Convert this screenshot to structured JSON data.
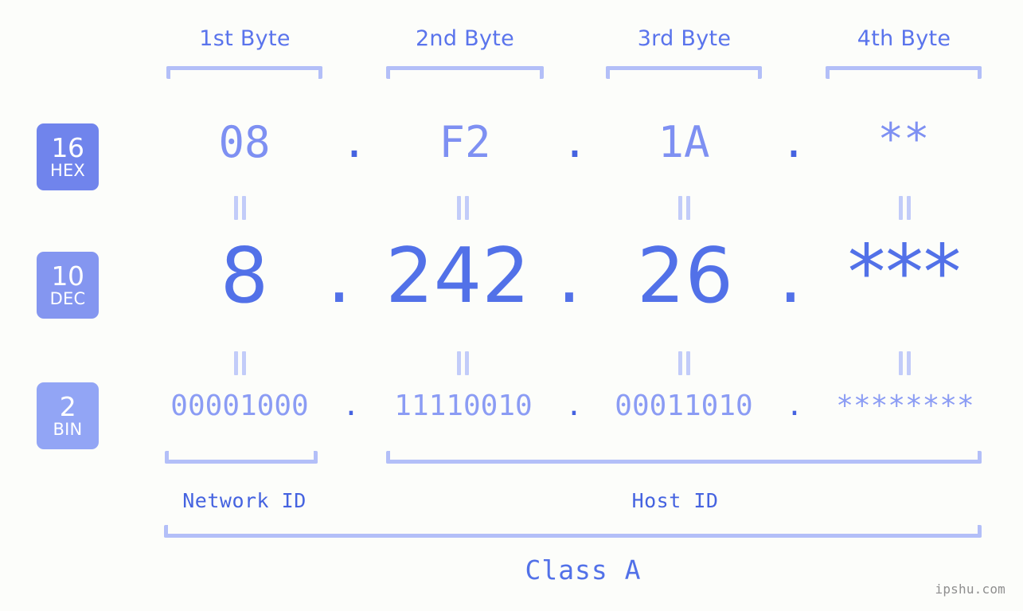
{
  "background_color": "#fcfdfa",
  "accent_color": "#5271e8",
  "light_accent_color": "#b3bff8",
  "byte_headers": [
    {
      "label": "1st Byte"
    },
    {
      "label": "2nd Byte"
    },
    {
      "label": "3rd Byte"
    },
    {
      "label": "4th Byte"
    }
  ],
  "radix_badges": [
    {
      "number": "16",
      "name": "HEX",
      "color": "#7084ec"
    },
    {
      "number": "10",
      "name": "DEC",
      "color": "#8496f0"
    },
    {
      "number": "2",
      "name": "BIN",
      "color": "#92a5f5"
    }
  ],
  "separator": ".",
  "equals_symbol": "=",
  "rows": {
    "hex": {
      "radix": "16",
      "radix_name": "HEX",
      "values": [
        "08",
        "F2",
        "1A",
        "**"
      ]
    },
    "dec": {
      "radix": "10",
      "radix_name": "DEC",
      "values": [
        "8",
        "242",
        "26",
        "***"
      ]
    },
    "bin": {
      "radix": "2",
      "radix_name": "BIN",
      "values": [
        "00001000",
        "11110010",
        "00011010",
        "********"
      ]
    }
  },
  "segments": {
    "network_id": "Network ID",
    "host_id": "Host ID",
    "ip_class": "Class A"
  },
  "watermark": "ipshu.com"
}
